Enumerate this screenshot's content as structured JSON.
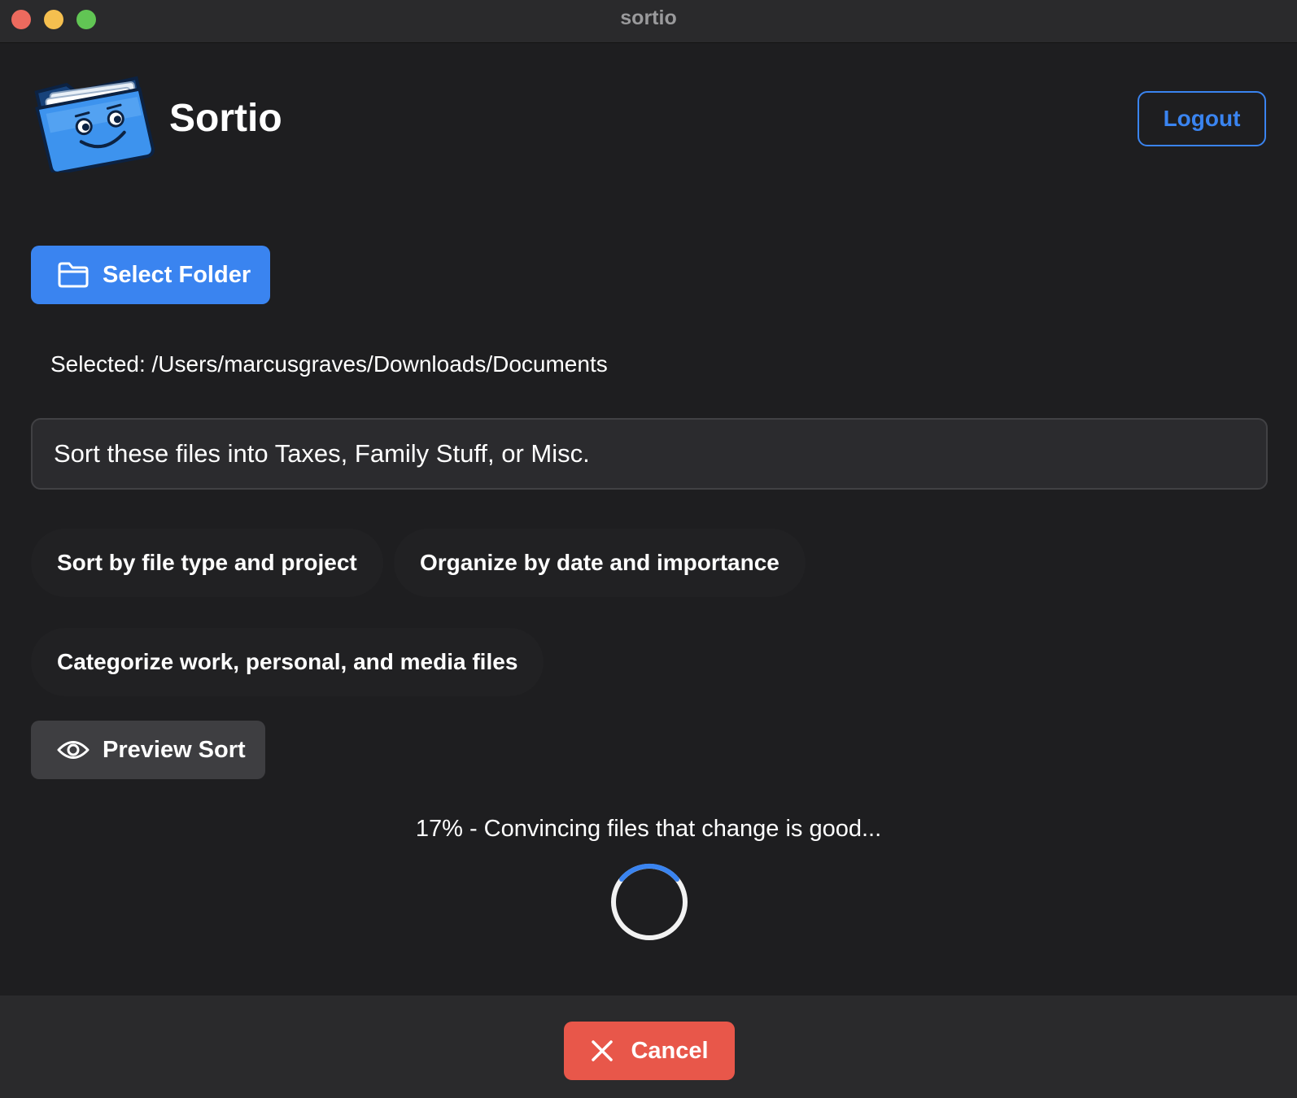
{
  "window": {
    "title": "sortio"
  },
  "header": {
    "app_name": "Sortio",
    "logout_label": "Logout",
    "logo_icon": "smiling-folder-icon"
  },
  "actions": {
    "select_folder_label": "Select Folder",
    "folder_icon": "folder-icon"
  },
  "selection": {
    "path_text": "Selected: /Users/marcusgraves/Downloads/Documents"
  },
  "prompt": {
    "value": "Sort these files into Taxes, Family Stuff, or Misc."
  },
  "suggestions": [
    "Sort by file type and project",
    "Organize by date and importance",
    "Categorize work, personal, and media files"
  ],
  "preview": {
    "label": "Preview Sort",
    "icon": "eye-icon"
  },
  "progress": {
    "text": "17% - Convincing files that change is good...",
    "percent": 17
  },
  "footer": {
    "cancel_label": "Cancel",
    "cancel_icon": "close-icon"
  },
  "colors": {
    "accent": "#3a84f0",
    "danger": "#e8574a",
    "background": "#1e1e20"
  }
}
